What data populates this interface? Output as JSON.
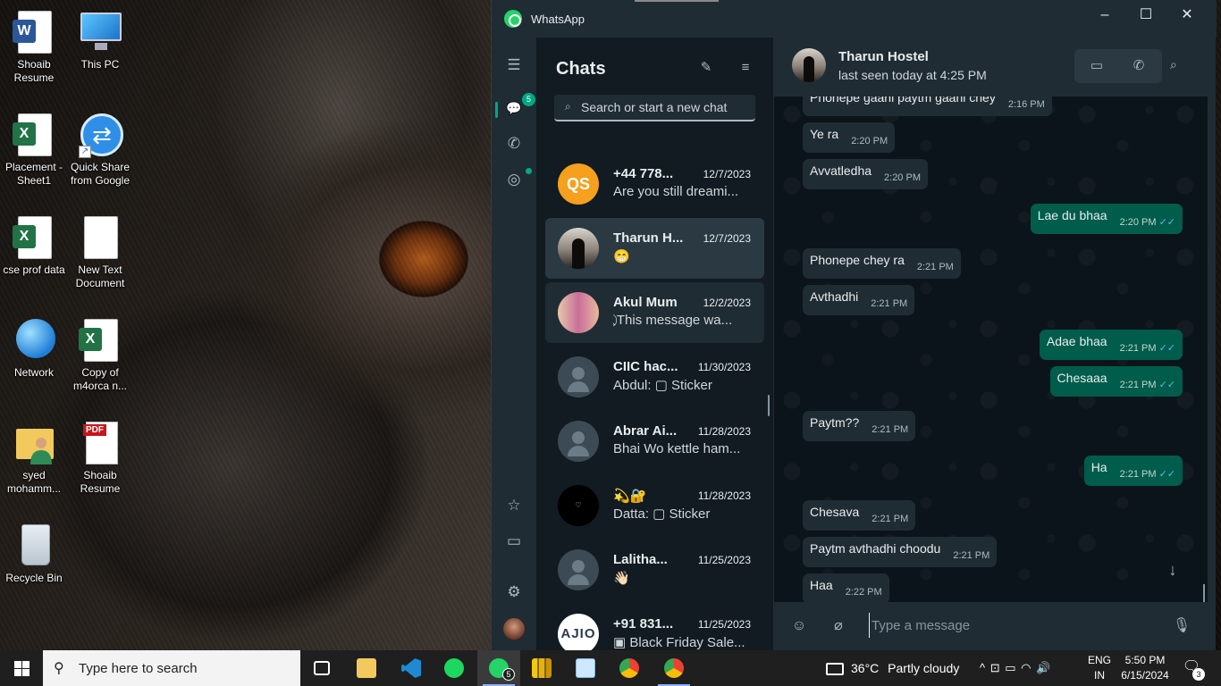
{
  "desktop": {
    "icons": [
      {
        "label": "Shoaib\nResume",
        "icon": "word-document-icon"
      },
      {
        "label": "This PC",
        "icon": "this-pc-icon"
      },
      {
        "label": "Placement - Sheet1",
        "icon": "excel-sheet-icon"
      },
      {
        "label": "Quick Share from Google",
        "icon": "quick-share-icon"
      },
      {
        "label": "cse prof data",
        "icon": "excel-sheet-icon"
      },
      {
        "label": "New Text Document",
        "icon": "text-document-icon"
      },
      {
        "label": "Network",
        "icon": "network-icon"
      },
      {
        "label": "Copy of m4orca n...",
        "icon": "excel-sheet-icon"
      },
      {
        "label": "syed mohamm...",
        "icon": "user-folder-icon"
      },
      {
        "label": "Shoaib Resume",
        "icon": "pdf-document-icon"
      },
      {
        "label": "Recycle Bin",
        "icon": "recycle-bin-icon"
      }
    ]
  },
  "window": {
    "app_name": "WhatsApp",
    "controls": {
      "minimize": "–",
      "maximize": "☐",
      "close": "✕"
    }
  },
  "rail": {
    "menu_glyph": "☰",
    "chats_glyph": "💬",
    "unread_count": "5",
    "calls_glyph": "✆",
    "status_glyph": "◎",
    "starred_glyph": "☆",
    "archived_glyph": "▭",
    "settings_glyph": "⚙"
  },
  "chat_list": {
    "title": "Chats",
    "new_chat_glyph": "✎",
    "filter_glyph": "≡",
    "search_placeholder": "Search or start a new chat",
    "search_glyph": "⌕",
    "chats": [
      {
        "name": "+44 778...",
        "date": "12/7/2023",
        "preview": "Are you still dreami...",
        "avatar": "QS"
      },
      {
        "name": "Tharun H...",
        "date": "12/7/2023",
        "preview": "😁",
        "avatar": ""
      },
      {
        "name": "Akul Mum",
        "date": "12/2/2023",
        "preview": "⃠ This message wa...",
        "avatar": ""
      },
      {
        "name": "CIIC hac...",
        "date": "11/30/2023",
        "preview": "Abdul: ▢ Sticker",
        "avatar": ""
      },
      {
        "name": "Abrar Ai...",
        "date": "11/28/2023",
        "preview": "Bhai Wo kettle ham...",
        "avatar": ""
      },
      {
        "name": "💫🔐",
        "date": "11/28/2023",
        "preview": "Datta: ▢ Sticker",
        "avatar": "♡"
      },
      {
        "name": "Lalitha...",
        "date": "11/25/2023",
        "preview": "👋🏻",
        "avatar": ""
      },
      {
        "name": "+91 831...",
        "date": "11/25/2023",
        "preview": "▣ Black Friday Sale...",
        "avatar": "AJIO"
      }
    ]
  },
  "conversation": {
    "contact_name": "Tharun Hostel",
    "last_seen": "last seen today at 4:25 PM",
    "video_glyph": "▭",
    "voice_glyph": "✆",
    "search_glyph": "⌕",
    "messages": [
      {
        "dir": "in",
        "text": "Phonepe gaani paytm gaani chey",
        "time": "2:16 PM"
      },
      {
        "dir": "in",
        "text": "Ye ra",
        "time": "2:20 PM"
      },
      {
        "dir": "in",
        "text": "Avvatledha",
        "time": "2:20 PM"
      },
      {
        "dir": "out",
        "text": "Lae du bhaa",
        "time": "2:20 PM"
      },
      {
        "dir": "in",
        "text": "Phonepe chey ra",
        "time": "2:21 PM"
      },
      {
        "dir": "in",
        "text": "Avthadhi",
        "time": "2:21 PM"
      },
      {
        "dir": "out",
        "text": "Adae bhaa",
        "time": "2:21 PM"
      },
      {
        "dir": "out",
        "text": "Chesaaa",
        "time": "2:21 PM"
      },
      {
        "dir": "in",
        "text": "Paytm??",
        "time": "2:21 PM"
      },
      {
        "dir": "out",
        "text": "Ha",
        "time": "2:21 PM"
      },
      {
        "dir": "in",
        "text": "Chesava",
        "time": "2:21 PM"
      },
      {
        "dir": "in",
        "text": "Paytm avthadhi choodu",
        "time": "2:21 PM"
      },
      {
        "dir": "in",
        "text": "Haa",
        "time": "2:22 PM"
      }
    ],
    "read_glyph": "✓✓",
    "scroll_down_glyph": "↓",
    "composer": {
      "emoji_glyph": "☺",
      "attach_glyph": "⌀",
      "placeholder": "Type a message",
      "mic_glyph": "🎙"
    }
  },
  "taskbar": {
    "search_placeholder": "Type here to search",
    "search_glyph": "⚲",
    "whatsapp_badge": "5",
    "weather_temp": "36°C",
    "weather_text": "Partly cloudy",
    "tray_glyphs": "^  ⊡  ▭  ◠  🔊",
    "lang_1": "ENG",
    "lang_2": "IN",
    "time": "5:50 PM",
    "date": "6/15/2024",
    "notification_glyph": "🗨",
    "notification_count": "3"
  }
}
